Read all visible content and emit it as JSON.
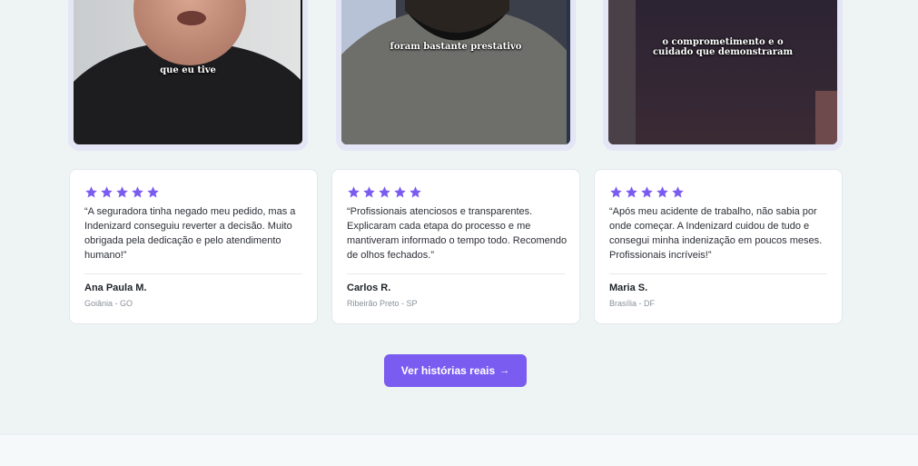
{
  "colors": {
    "accent": "#7b5cf0",
    "star": "#7b5cf0"
  },
  "videos": [
    {
      "caption": "que eu tive"
    },
    {
      "caption": "foram bastante prestativo"
    },
    {
      "caption": "o comprometimento e o\ncuidado que demonstraram"
    }
  ],
  "testimonials": [
    {
      "rating": 5,
      "quote": "“A seguradora tinha negado meu pedido, mas a Indenizard conseguiu reverter a decisão. Muito obrigada pela dedicação e pelo atendimento humano!”",
      "name": "Ana Paula M.",
      "location": "Goiânia - GO"
    },
    {
      "rating": 5,
      "quote": "“Profissionais atenciosos e transparentes. Explicaram cada etapa do processo e me mantiveram informado o tempo todo. Recomendo de olhos fechados.”",
      "name": "Carlos R.",
      "location": "Ribeirão Preto - SP"
    },
    {
      "rating": 5,
      "quote": "“Após meu acidente de trabalho, não sabia por onde começar. A Indenizard cuidou de tudo e consegui minha indenização em poucos meses. Profissionais incríveis!”",
      "name": "Maria S.",
      "location": "Brasília - DF"
    }
  ],
  "cta": {
    "label": "Ver histórias reais",
    "arrow_icon": "arrow-right-icon",
    "arrow": "→"
  }
}
